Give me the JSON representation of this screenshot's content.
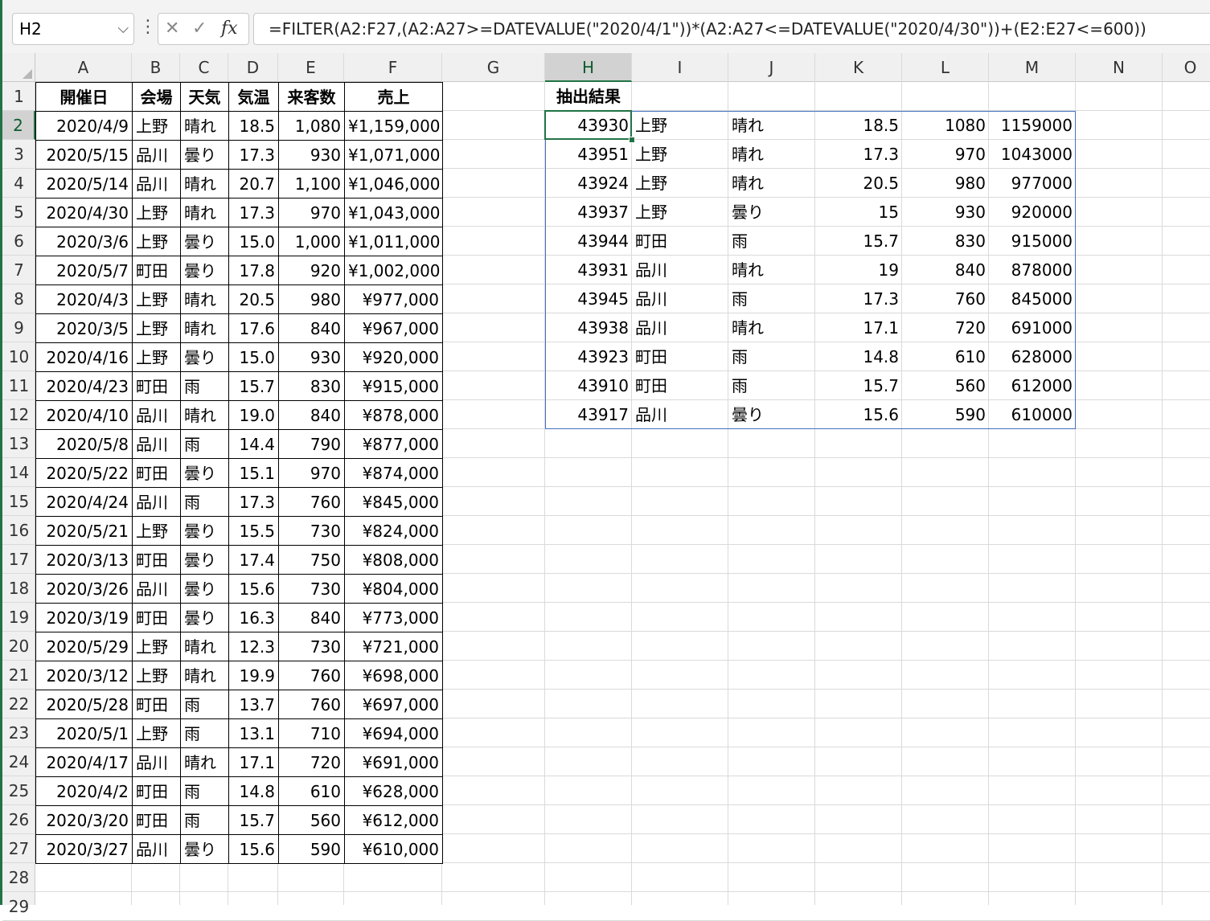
{
  "formula_bar": {
    "name_box": "H2",
    "formula": "=FILTER(A2:F27,(A2:A27>=DATEVALUE(\"2020/4/1\"))*(A2:A27<=DATEVALUE(\"2020/4/30\"))+(E2:E27<=600))",
    "cancel_glyph": "✕",
    "enter_glyph": "✓",
    "fx_glyph": "fx"
  },
  "columns": [
    "A",
    "B",
    "C",
    "D",
    "E",
    "F",
    "G",
    "H",
    "I",
    "J",
    "K",
    "L",
    "M",
    "N",
    "O"
  ],
  "rows": [
    "1",
    "2",
    "3",
    "4",
    "5",
    "6",
    "7",
    "8",
    "9",
    "10",
    "11",
    "12",
    "13",
    "14",
    "15",
    "16",
    "17",
    "18",
    "19",
    "20",
    "21",
    "22",
    "23",
    "24",
    "25",
    "26",
    "27",
    "28",
    "29"
  ],
  "selected_column": "H",
  "selected_row": "2",
  "table": {
    "headers": [
      "開催日",
      "会場",
      "天気",
      "気温",
      "来客数",
      "売上"
    ],
    "rows": [
      [
        "2020/4/9",
        "上野",
        "晴れ",
        "18.5",
        "1,080",
        "¥1,159,000"
      ],
      [
        "2020/5/15",
        "品川",
        "曇り",
        "17.3",
        "930",
        "¥1,071,000"
      ],
      [
        "2020/5/14",
        "品川",
        "晴れ",
        "20.7",
        "1,100",
        "¥1,046,000"
      ],
      [
        "2020/4/30",
        "上野",
        "晴れ",
        "17.3",
        "970",
        "¥1,043,000"
      ],
      [
        "2020/3/6",
        "上野",
        "曇り",
        "15.0",
        "1,000",
        "¥1,011,000"
      ],
      [
        "2020/5/7",
        "町田",
        "曇り",
        "17.8",
        "920",
        "¥1,002,000"
      ],
      [
        "2020/4/3",
        "上野",
        "晴れ",
        "20.5",
        "980",
        "¥977,000"
      ],
      [
        "2020/3/5",
        "上野",
        "晴れ",
        "17.6",
        "840",
        "¥967,000"
      ],
      [
        "2020/4/16",
        "上野",
        "曇り",
        "15.0",
        "930",
        "¥920,000"
      ],
      [
        "2020/4/23",
        "町田",
        "雨",
        "15.7",
        "830",
        "¥915,000"
      ],
      [
        "2020/4/10",
        "品川",
        "晴れ",
        "19.0",
        "840",
        "¥878,000"
      ],
      [
        "2020/5/8",
        "品川",
        "雨",
        "14.4",
        "790",
        "¥877,000"
      ],
      [
        "2020/5/22",
        "町田",
        "曇り",
        "15.1",
        "970",
        "¥874,000"
      ],
      [
        "2020/4/24",
        "品川",
        "雨",
        "17.3",
        "760",
        "¥845,000"
      ],
      [
        "2020/5/21",
        "上野",
        "曇り",
        "15.5",
        "730",
        "¥824,000"
      ],
      [
        "2020/3/13",
        "町田",
        "曇り",
        "17.4",
        "750",
        "¥808,000"
      ],
      [
        "2020/3/26",
        "品川",
        "曇り",
        "15.6",
        "730",
        "¥804,000"
      ],
      [
        "2020/3/19",
        "町田",
        "曇り",
        "16.3",
        "840",
        "¥773,000"
      ],
      [
        "2020/5/29",
        "上野",
        "晴れ",
        "12.3",
        "730",
        "¥721,000"
      ],
      [
        "2020/3/12",
        "上野",
        "晴れ",
        "19.9",
        "760",
        "¥698,000"
      ],
      [
        "2020/5/28",
        "町田",
        "雨",
        "13.7",
        "760",
        "¥697,000"
      ],
      [
        "2020/5/1",
        "上野",
        "雨",
        "13.1",
        "710",
        "¥694,000"
      ],
      [
        "2020/4/17",
        "品川",
        "晴れ",
        "17.1",
        "720",
        "¥691,000"
      ],
      [
        "2020/4/2",
        "町田",
        "雨",
        "14.8",
        "610",
        "¥628,000"
      ],
      [
        "2020/3/20",
        "町田",
        "雨",
        "15.7",
        "560",
        "¥612,000"
      ],
      [
        "2020/3/27",
        "品川",
        "曇り",
        "15.6",
        "590",
        "¥610,000"
      ]
    ]
  },
  "result": {
    "title": "抽出結果",
    "rows": [
      [
        "43930",
        "上野",
        "晴れ",
        "18.5",
        "1080",
        "1159000"
      ],
      [
        "43951",
        "上野",
        "晴れ",
        "17.3",
        "970",
        "1043000"
      ],
      [
        "43924",
        "上野",
        "晴れ",
        "20.5",
        "980",
        "977000"
      ],
      [
        "43937",
        "上野",
        "曇り",
        "15",
        "930",
        "920000"
      ],
      [
        "43944",
        "町田",
        "雨",
        "15.7",
        "830",
        "915000"
      ],
      [
        "43931",
        "品川",
        "晴れ",
        "19",
        "840",
        "878000"
      ],
      [
        "43945",
        "品川",
        "雨",
        "17.3",
        "760",
        "845000"
      ],
      [
        "43938",
        "品川",
        "晴れ",
        "17.1",
        "720",
        "691000"
      ],
      [
        "43923",
        "町田",
        "雨",
        "14.8",
        "610",
        "628000"
      ],
      [
        "43910",
        "町田",
        "雨",
        "15.7",
        "560",
        "612000"
      ],
      [
        "43917",
        "品川",
        "曇り",
        "15.6",
        "590",
        "610000"
      ]
    ]
  }
}
